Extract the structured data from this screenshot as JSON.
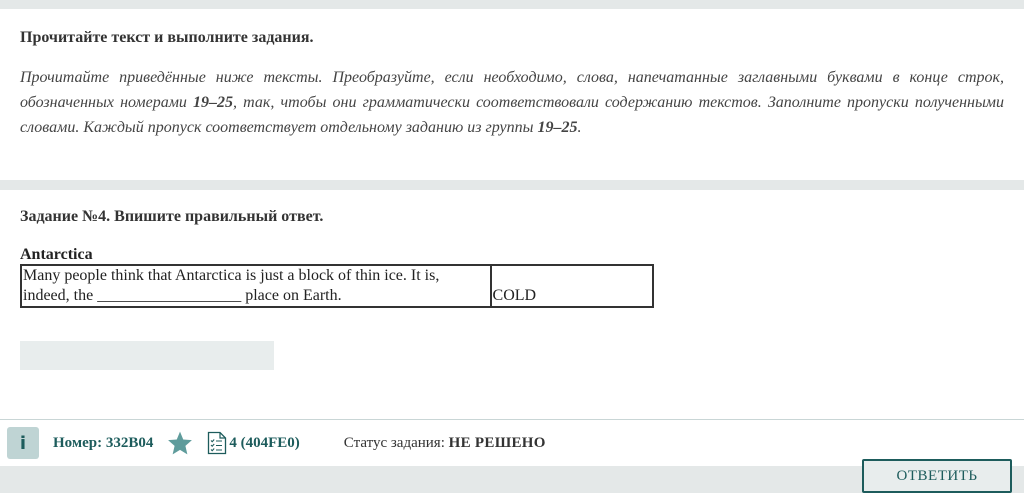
{
  "instructions": {
    "title": "Прочитайте текст и выполните задания.",
    "body_part1": "Прочитайте приведённые ниже тексты. Преобразуйте, если необходимо, слова, напечатанные заглавными буквами в конце строк, обозначенных номерами ",
    "range1": "19–25",
    "body_part2": ", так, чтобы они грамматически соответствовали содержанию текстов. Заполните пропуски полученными словами. Каждый пропуск соответствует отдельному заданию из группы ",
    "range2": "19–25",
    "body_part3": "."
  },
  "task": {
    "title": "Задание №4. Впишите правильный ответ.",
    "text_title": "Antarctica",
    "sentence": "Many people think that Antarctica is just a block of thin ice. It is, indeed, the __________________ place on Earth.",
    "keyword": "COLD",
    "answer_value": ""
  },
  "footer": {
    "info_label": "i",
    "number_label": "Номер: 332B04",
    "variant_label": "4 (404FE0)",
    "status_label": "Статус задания: ",
    "status_value": "НЕ РЕШЕНО",
    "answer_button": "ОТВЕТИТЬ"
  },
  "icons": {
    "favorite": "star-icon",
    "variant": "document-list-icon"
  },
  "colors": {
    "accent": "#1d5c5c",
    "star": "#5f9c9c"
  }
}
